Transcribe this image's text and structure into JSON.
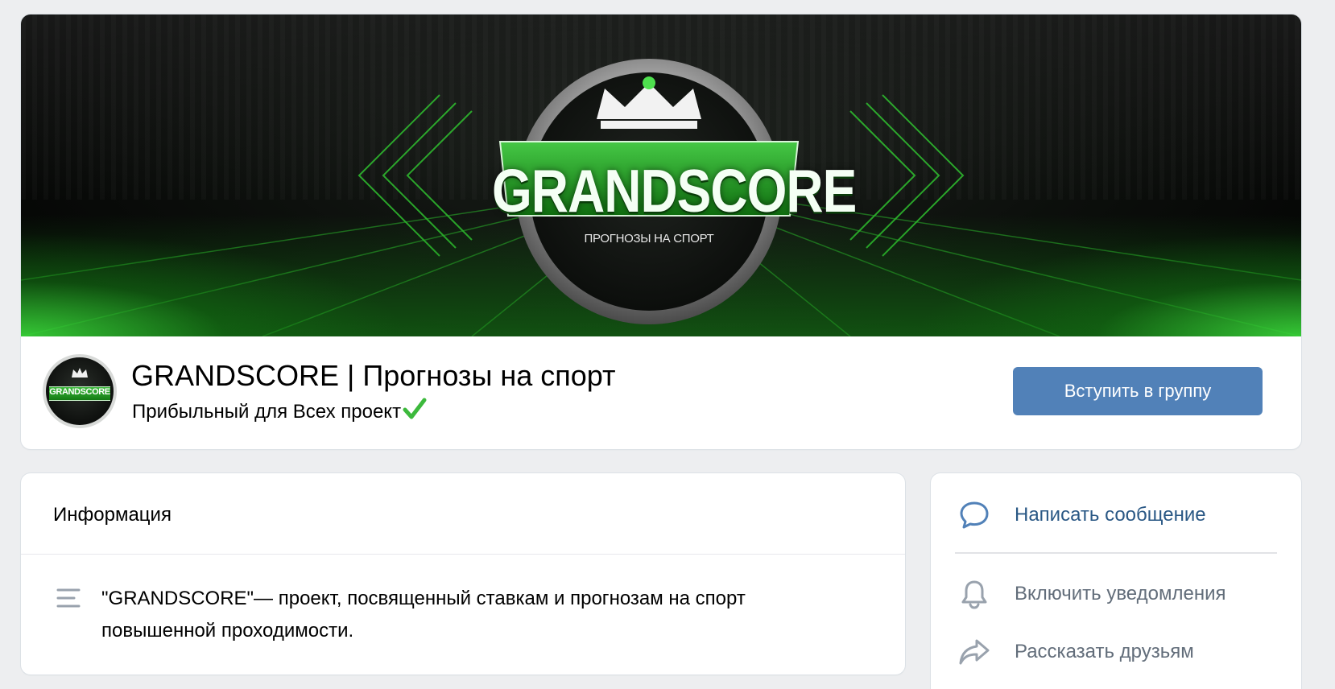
{
  "cover": {
    "logo_title": "GRANDSCORE",
    "logo_subtitle": "ПРОГНОЗЫ НА СПОРТ",
    "accent_color": "#2fbf2f"
  },
  "group": {
    "avatar_text": "GRANDSCORE",
    "name": "GRANDSCORE | Прогнозы на спорт",
    "status": "Прибыльный для Всех проект",
    "status_icon": "check-mark-icon",
    "join_label": "Вступить в группу",
    "join_color": "#5181b8"
  },
  "info": {
    "title": "Информация",
    "description_icon": "text-lines-icon",
    "description": "\"GRANDSCORE\"— проект, посвященный ставкам и прогнозам на спорт повышенной проходимости."
  },
  "actions": {
    "items": [
      {
        "label": "Написать сообщение",
        "icon": "message-bubble-icon"
      },
      {
        "label": "Включить уведомления",
        "icon": "bell-icon"
      },
      {
        "label": "Рассказать друзьям",
        "icon": "share-arrow-icon"
      }
    ]
  }
}
